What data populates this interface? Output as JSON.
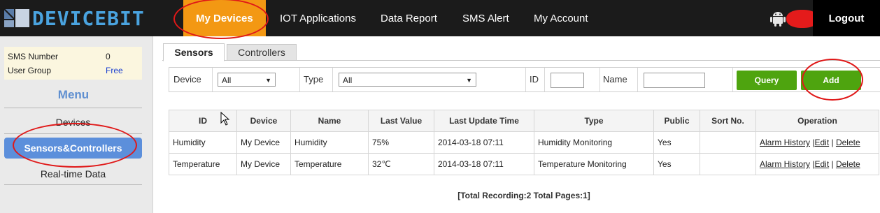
{
  "brand": {
    "name": "DEVICEBIT"
  },
  "nav": {
    "items": [
      "My Devices",
      "IOT Applications",
      "Data Report",
      "SMS Alert",
      "My Account"
    ],
    "active_index": 0,
    "logout": "Logout"
  },
  "sidebar": {
    "sms_label": "SMS Number",
    "sms_value": "0",
    "group_label": "User Group",
    "group_value": "Free",
    "menu_title": "Menu",
    "items": [
      "Devices",
      "Sensors&Controllers",
      "Real-time Data"
    ],
    "active_index": 1
  },
  "tabs": [
    "Sensors",
    "Controllers"
  ],
  "filters": {
    "device_label": "Device",
    "device_value": "All",
    "type_label": "Type",
    "type_value": "All",
    "id_label": "ID",
    "id_value": "",
    "name_label": "Name",
    "name_value": "",
    "query": "Query",
    "add": "Add"
  },
  "table": {
    "headers": [
      "ID",
      "Device",
      "Name",
      "Last Value",
      "Last Update Time",
      "Type",
      "Public",
      "Sort No.",
      "Operation"
    ],
    "rows": [
      {
        "id": "Humidity",
        "device": "My Device",
        "name": "Humidity",
        "value": "75%",
        "time": "2014-03-18 07:11",
        "type": "Humidity Monitoring",
        "public": "Yes",
        "sort": ""
      },
      {
        "id": "Temperature",
        "device": "My Device",
        "name": "Temperature",
        "value": "32℃",
        "time": "2014-03-18 07:11",
        "type": "Temperature Monitoring",
        "public": "Yes",
        "sort": ""
      }
    ],
    "ops": {
      "alarm": "Alarm History",
      "sep1": " |",
      "edit": "Edit",
      "sep2": " | ",
      "delete": "Delete"
    },
    "footer": "[Total Recording:2 Total Pages:1]"
  },
  "colors": {
    "accent": "#f39813",
    "menu_active": "#5c8fdb",
    "button": "#4ea40f",
    "annotation": "#e01818"
  }
}
